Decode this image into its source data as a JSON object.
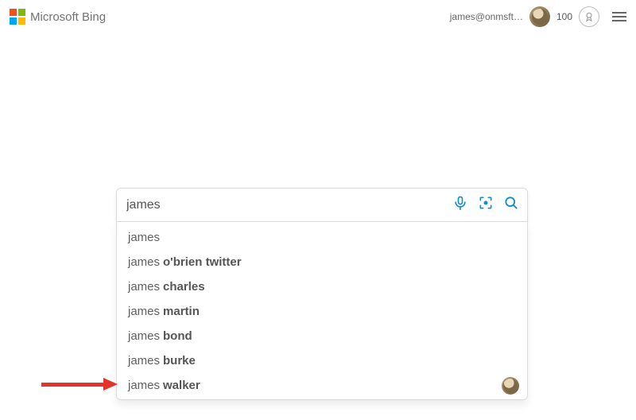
{
  "header": {
    "brand": "Microsoft Bing",
    "email": "james@onmsft…",
    "points": "100"
  },
  "search": {
    "query": "james",
    "placeholder": ""
  },
  "suggestions": [
    {
      "prefix": "james",
      "suffix": "",
      "has_avatar": false
    },
    {
      "prefix": "james ",
      "suffix": "o'brien twitter",
      "has_avatar": false
    },
    {
      "prefix": "james ",
      "suffix": "charles",
      "has_avatar": false
    },
    {
      "prefix": "james ",
      "suffix": "martin",
      "has_avatar": false
    },
    {
      "prefix": "james ",
      "suffix": "bond",
      "has_avatar": false
    },
    {
      "prefix": "james ",
      "suffix": "burke",
      "has_avatar": false
    },
    {
      "prefix": "james ",
      "suffix": "walker",
      "has_avatar": true
    }
  ]
}
